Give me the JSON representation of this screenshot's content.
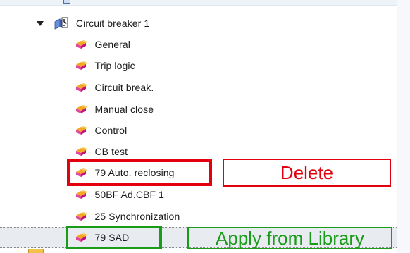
{
  "tree": {
    "parent": {
      "label": "Circuit breaker 1",
      "expanded": true,
      "icon": "circuit-breaker-icon"
    },
    "children": [
      {
        "label": "General",
        "icon": "function-block-icon"
      },
      {
        "label": "Trip logic",
        "icon": "function-block-icon"
      },
      {
        "label": "Circuit break.",
        "icon": "function-block-icon"
      },
      {
        "label": "Manual close",
        "icon": "function-block-icon"
      },
      {
        "label": "Control",
        "icon": "function-block-icon"
      },
      {
        "label": "CB test",
        "icon": "function-block-icon"
      },
      {
        "label": "79 Auto. reclosing",
        "icon": "function-block-icon",
        "highlight": "red"
      },
      {
        "label": "50BF Ad.CBF 1",
        "icon": "function-block-icon"
      },
      {
        "label": "25 Synchronization",
        "icon": "function-block-icon"
      },
      {
        "label": "79 SAD",
        "icon": "function-block-icon",
        "highlight": "green",
        "selected": true
      }
    ]
  },
  "annotations": {
    "delete": "Delete",
    "apply": "Apply from Library"
  },
  "colors": {
    "annotation_red": "#e3000f",
    "annotation_green": "#1a9b1a",
    "icon_pink": "#d81b8a",
    "icon_orange": "#f5a623",
    "selection_bg": "#e8ecf0"
  }
}
